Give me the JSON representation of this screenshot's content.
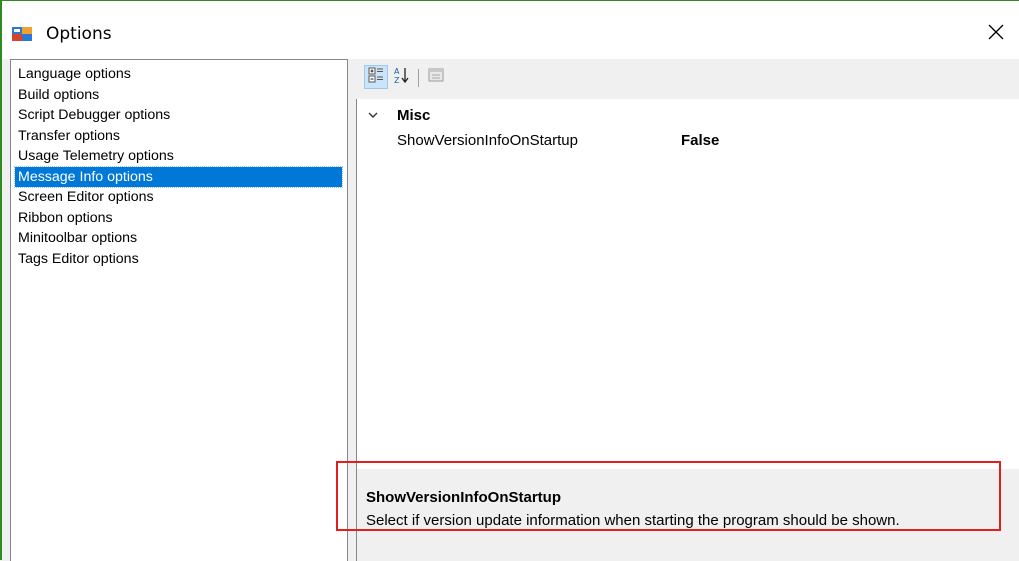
{
  "window": {
    "title": "Options",
    "close_symbol": "✕",
    "accent_color": "#2e8b22"
  },
  "left_list": {
    "items": [
      {
        "label": "Language options",
        "selected": false
      },
      {
        "label": "Build options",
        "selected": false
      },
      {
        "label": "Script Debugger options",
        "selected": false
      },
      {
        "label": "Transfer options",
        "selected": false
      },
      {
        "label": "Usage Telemetry options",
        "selected": false
      },
      {
        "label": "Message Info options",
        "selected": true
      },
      {
        "label": "Screen Editor options",
        "selected": false
      },
      {
        "label": "Ribbon options",
        "selected": false
      },
      {
        "label": "Minitoolbar options",
        "selected": false
      },
      {
        "label": "Tags Editor options",
        "selected": false
      }
    ],
    "selection_color": "#0078d7"
  },
  "toolbar": {
    "buttons": [
      {
        "icon": "categorized-icon",
        "active": true
      },
      {
        "icon": "alphabetical-sort-icon",
        "active": false
      },
      {
        "icon": "property-pages-icon",
        "active": false
      }
    ]
  },
  "property_grid": {
    "category": "Misc",
    "properties": [
      {
        "name": "ShowVersionInfoOnStartup",
        "value": "False"
      }
    ]
  },
  "description": {
    "title": "ShowVersionInfoOnStartup",
    "text": "Select if version update information when starting the program should be shown.",
    "highlight_color": "#e02020"
  }
}
